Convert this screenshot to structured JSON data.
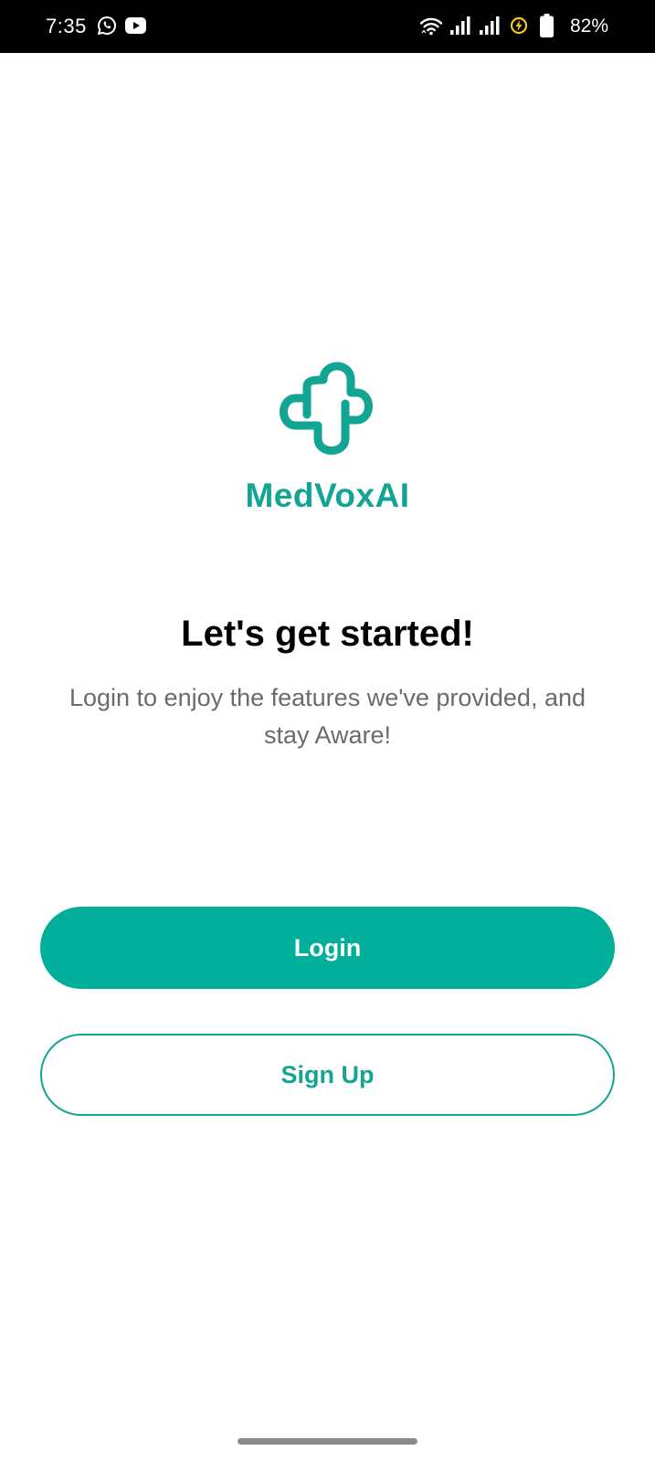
{
  "status_bar": {
    "time": "7:35",
    "battery_percent": "82%",
    "icons": [
      "whatsapp-icon",
      "youtube-icon",
      "wifi-icon",
      "signal-icon",
      "signal-icon",
      "charging-icon",
      "battery-icon"
    ]
  },
  "brand": {
    "name": "MedVoxAI",
    "color": "#12a594"
  },
  "welcome": {
    "headline": "Let's get started!",
    "subtitle": "Login to enjoy the features we've provided, and stay Aware!"
  },
  "actions": {
    "login_label": "Login",
    "signup_label": "Sign Up",
    "primary_color": "#00ae9a"
  }
}
